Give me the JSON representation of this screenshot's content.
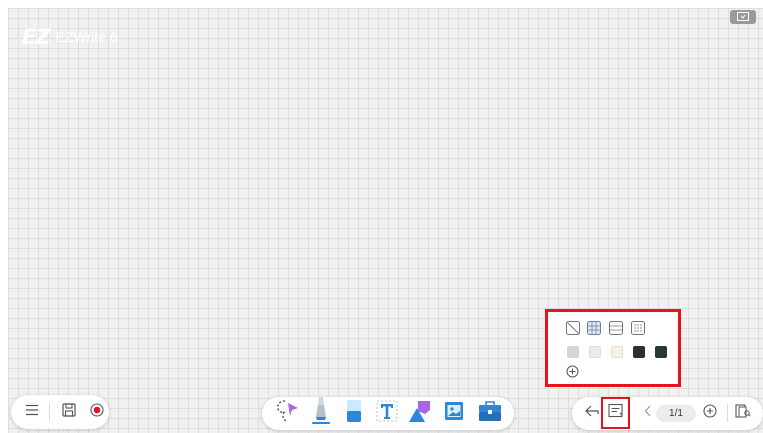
{
  "app": {
    "name": "EZWrite 6",
    "logo_mark": "EZ"
  },
  "window": {
    "screen_icon": "screen-capture-icon"
  },
  "toolbar_left": {
    "items": [
      {
        "name": "menu",
        "icon": "menu-icon"
      },
      {
        "name": "save",
        "icon": "save-icon"
      },
      {
        "name": "record",
        "icon": "record-icon"
      }
    ]
  },
  "toolbar_center": {
    "items": [
      {
        "name": "lasso",
        "icon": "lasso-select-icon"
      },
      {
        "name": "pen",
        "icon": "pen-icon",
        "selected": true
      },
      {
        "name": "eraser",
        "icon": "eraser-icon"
      },
      {
        "name": "text",
        "icon": "text-icon"
      },
      {
        "name": "shapes",
        "icon": "shapes-icon"
      },
      {
        "name": "image",
        "icon": "image-icon"
      },
      {
        "name": "toolbox",
        "icon": "toolbox-icon"
      }
    ]
  },
  "toolbar_right": {
    "page_indicator": "1/1",
    "items": [
      {
        "name": "back",
        "icon": "back-icon"
      },
      {
        "name": "background",
        "icon": "background-settings-icon",
        "highlighted": true
      },
      {
        "name": "previous-page",
        "icon": "chevron-left-icon"
      },
      {
        "name": "add-page",
        "icon": "add-page-icon"
      },
      {
        "name": "page-manager",
        "icon": "page-manager-icon"
      }
    ]
  },
  "background_popup": {
    "grid_options": [
      {
        "name": "none",
        "icon": "no-grid-icon"
      },
      {
        "name": "grid",
        "icon": "grid-icon",
        "selected": true
      },
      {
        "name": "lines",
        "icon": "lined-icon"
      },
      {
        "name": "dots",
        "icon": "dotted-icon"
      }
    ],
    "colors": [
      "#d5d5d5",
      "#ebebeb",
      "#f6f1e6",
      "#2f2f2f",
      "#263b30"
    ],
    "add_color_icon": "add-color-icon"
  },
  "colors": {
    "accent_blue": "#2f86d6",
    "highlight_red": "#e5131b",
    "record_red": "#e5132b"
  }
}
